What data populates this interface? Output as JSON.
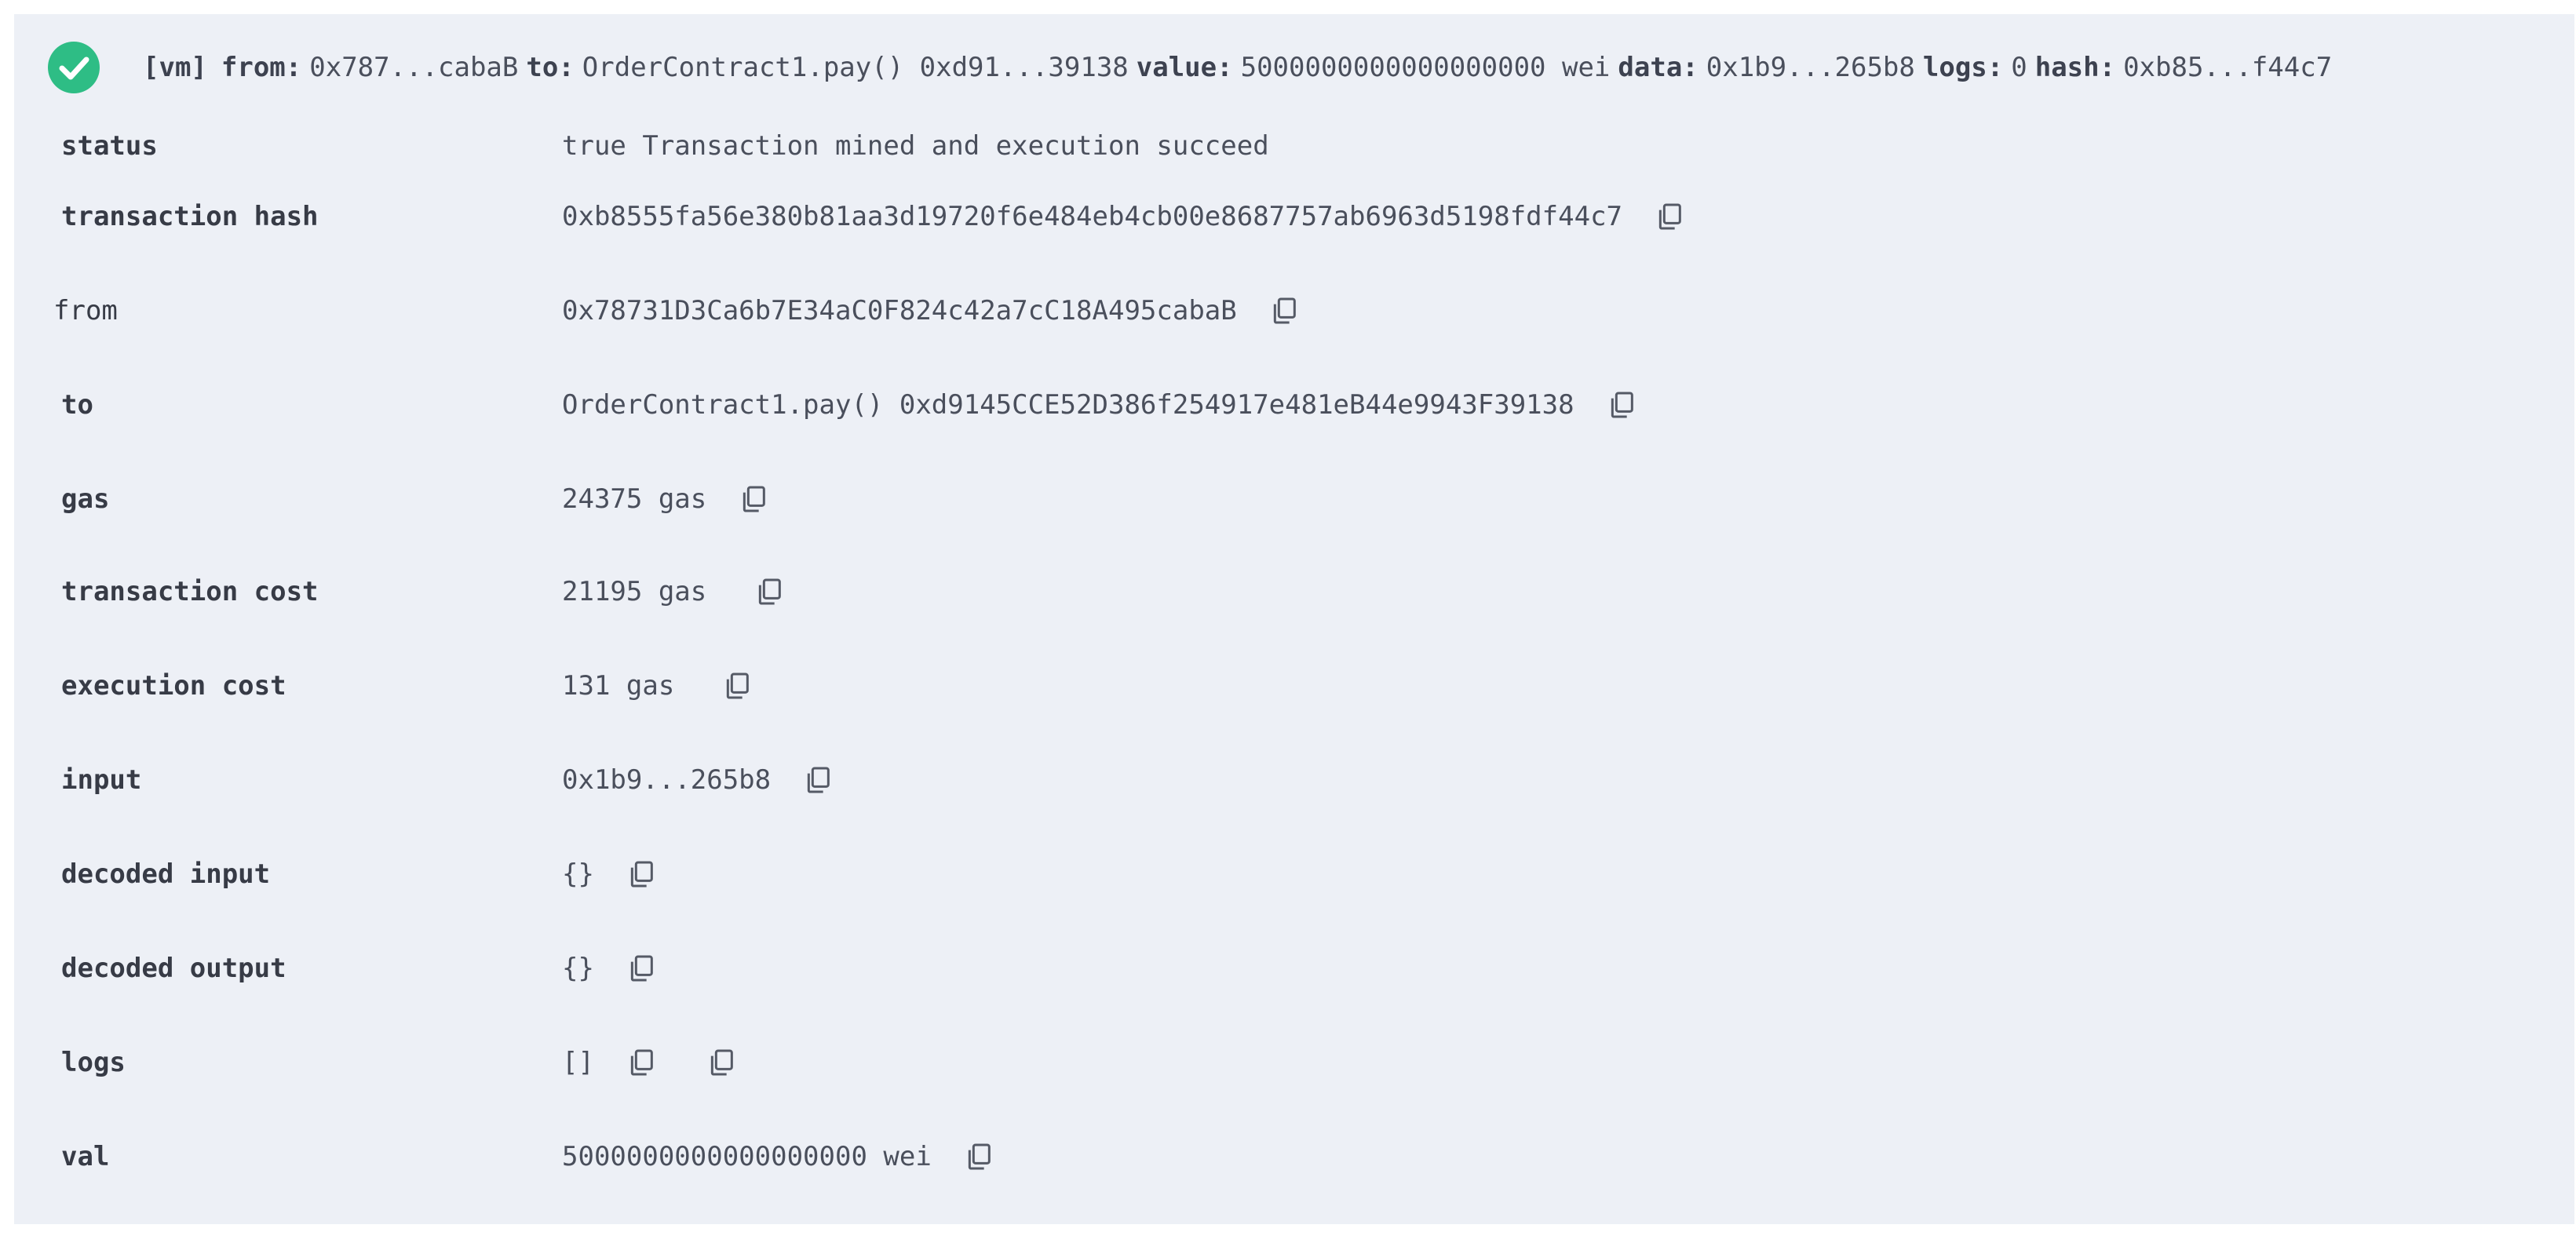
{
  "header": {
    "vm_tag": "[vm]",
    "from_label": "from:",
    "from_value": "0x787...cabaB",
    "to_label": "to:",
    "to_value": "OrderContract1.pay() 0xd91...39138",
    "value_label": "value:",
    "value_value": "5000000000000000000 wei",
    "data_label": "data:",
    "data_value": "0x1b9...265b8",
    "logs_label": "logs:",
    "logs_value": "0",
    "hash_label": "hash:",
    "hash_value": "0xb85...f44c7"
  },
  "rows": [
    {
      "key": "status",
      "value": "true Transaction mined and execution succeed"
    },
    {
      "key": "transaction hash",
      "value": "0xb8555fa56e380b81aa3d19720f6e484eb4cb00e8687757ab6963d5198fdf44c7"
    },
    {
      "key": "from",
      "value": "0x78731D3Ca6b7E34aC0F824c42a7cC18A495cabaB"
    },
    {
      "key": "to",
      "value": "OrderContract1.pay() 0xd9145CCE52D386f254917e481eB44e9943F39138"
    },
    {
      "key": "gas",
      "value": "24375 gas"
    },
    {
      "key": "transaction cost",
      "value": "21195 gas"
    },
    {
      "key": "execution cost",
      "value": "131 gas"
    },
    {
      "key": "input",
      "value": "0x1b9...265b8"
    },
    {
      "key": "decoded input",
      "value": "{}"
    },
    {
      "key": "decoded output",
      "value": "{}"
    },
    {
      "key": "logs",
      "value": "[]"
    },
    {
      "key": "val",
      "value": "5000000000000000000 wei"
    }
  ],
  "colors": {
    "panel_bg": "#edf0f6",
    "success_green": "#2ebd85",
    "text": "#3b3f4a"
  },
  "icons": {
    "status": "check-circle-icon",
    "copy": "copy-icon"
  }
}
